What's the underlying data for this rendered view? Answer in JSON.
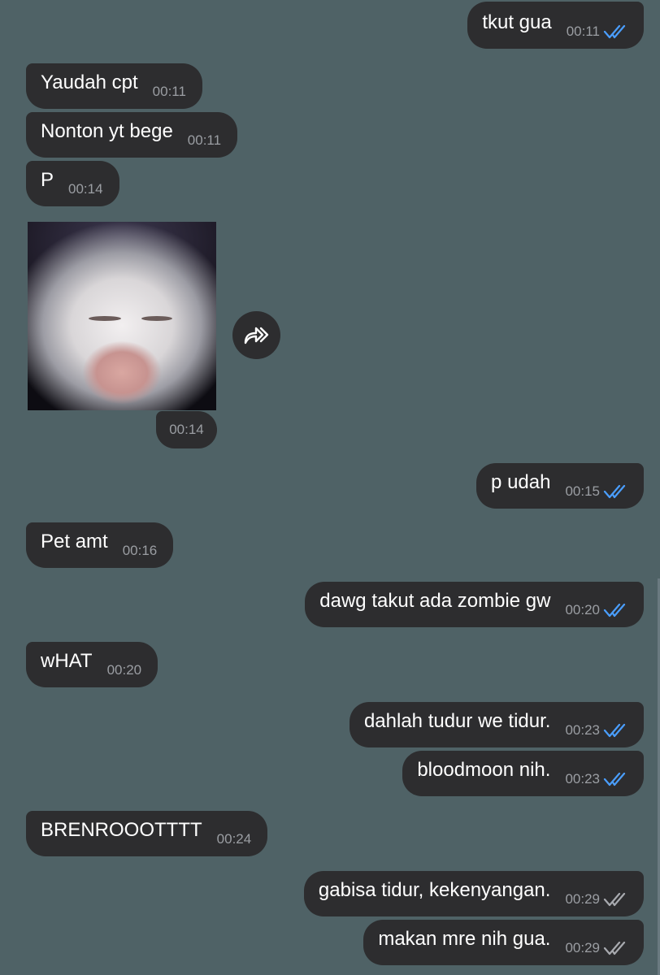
{
  "colors": {
    "background": "#4f6266",
    "bubble": "#2d2d2f",
    "text": "#ffffff",
    "time": "#9b9ea3",
    "tick_read": "#4a9eff",
    "tick_delivered": "#a8aaaf"
  },
  "messages": [
    {
      "dir": "out",
      "text": "tkut gua",
      "time": "00:11",
      "status": "read"
    },
    {
      "dir": "in",
      "text": "Yaudah cpt",
      "time": "00:11"
    },
    {
      "dir": "in",
      "text": "Nonton yt bege",
      "time": "00:11"
    },
    {
      "dir": "in",
      "text": "P",
      "time": "00:14"
    },
    {
      "dir": "in",
      "type": "photo",
      "icon": "cat-photo",
      "time": "00:14",
      "forward_icon": "forward-icon"
    },
    {
      "dir": "out",
      "text": "p udah",
      "time": "00:15",
      "status": "read"
    },
    {
      "dir": "in",
      "text": "Pet amt",
      "time": "00:16"
    },
    {
      "dir": "out",
      "text": "dawg takut ada zombie gw",
      "time": "00:20",
      "status": "read"
    },
    {
      "dir": "in",
      "text": "wHAT",
      "time": "00:20"
    },
    {
      "dir": "out",
      "text": "dahlah tudur we tidur.",
      "time": "00:23",
      "status": "read"
    },
    {
      "dir": "out",
      "text": "bloodmoon nih.",
      "time": "00:23",
      "status": "read"
    },
    {
      "dir": "in",
      "text": "BRENROOOTTTT",
      "time": "00:24"
    },
    {
      "dir": "out",
      "text": "gabisa tidur, kekenyangan.",
      "time": "00:29",
      "status": "delivered"
    },
    {
      "dir": "out",
      "text": "makan mre nih gua.",
      "time": "00:29",
      "status": "delivered"
    }
  ]
}
